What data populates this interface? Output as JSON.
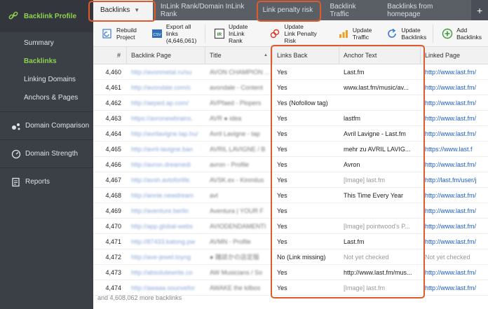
{
  "sidebar": {
    "header": "Backlink Profile",
    "subitems": [
      "Summary",
      "Backlinks",
      "Linking Domains",
      "Anchors & Pages"
    ],
    "active_index": 1,
    "sections": [
      "Domain Comparison",
      "Domain Strength",
      "Reports"
    ]
  },
  "tabs": [
    "Backlinks",
    "InLink Rank/Domain InLink Rank",
    "Link penalty risk",
    "Backlink Traffic",
    "Backlinks from homepage"
  ],
  "toolbar": [
    {
      "label": "Rebuild\nProject",
      "icon": "rebuild-icon"
    },
    {
      "label": "Export all links\n(4,646,061)",
      "icon": "csv-export-icon"
    },
    {
      "label": "Update\nInLink Rank",
      "icon": "ir-icon"
    },
    {
      "label": "Update\nLink Penalty Risk",
      "icon": "penalty-icon"
    },
    {
      "label": "Update\nTraffic",
      "icon": "traffic-icon"
    },
    {
      "label": "Update\nBacklinks",
      "icon": "refresh-icon"
    },
    {
      "label": "Add\nBacklinks",
      "icon": "add-icon"
    }
  ],
  "columns": [
    "#",
    "Backlink Page",
    "Title",
    "Links Back",
    "Anchor Text",
    "Linked Page"
  ],
  "rows": [
    {
      "n": "4,460",
      "page": "http://avonmetal.ru/su",
      "title": "AVON CHAMPION - Профи",
      "back": "Yes",
      "anchor": "Last.fm",
      "linked": "http://www.last.fm/",
      "anchor_grey": false
    },
    {
      "n": "4,461",
      "page": "http://avondale.com/c",
      "title": "avondale - Content",
      "back": "Yes",
      "anchor": "www.last.fm/music/av...",
      "linked": "http://www.last.fm/",
      "anchor_grey": false
    },
    {
      "n": "4,462",
      "page": "http://aeped.ap.com/",
      "title": "AVPfaed - Plopers",
      "back": "Yes (Nofollow tag)",
      "anchor": "",
      "linked": "http://www.last.fm/",
      "anchor_grey": false
    },
    {
      "n": "4,463",
      "page": "https://avronewbrains.",
      "title": "AVR ● idea",
      "back": "Yes",
      "anchor": "lastfm",
      "linked": "http://www.last.fm/",
      "anchor_grey": false
    },
    {
      "n": "4,464",
      "page": "http://avrilavigne.tap.hu/",
      "title": "Avril Lavigne - tap",
      "back": "Yes",
      "anchor": "Avril Lavigne - Last.fm",
      "linked": "http://www.last.fm/",
      "anchor_grey": false
    },
    {
      "n": "4,465",
      "page": "http://avril-lavigne.ban",
      "title": "AVRIL LAVIGNE / B",
      "back": "Yes",
      "anchor": "mehr zu AVRIL LAVIG...",
      "linked": "https://www.last.f",
      "anchor_grey": false
    },
    {
      "n": "4,466",
      "page": "http://avron.dreamedi",
      "title": "avron - Profile",
      "back": "Yes",
      "anchor": "Avron",
      "linked": "http://www.last.fm/",
      "anchor_grey": false
    },
    {
      "n": "4,467",
      "page": "http://avsh.avtoforlife.",
      "title": "AVSK.ex - Kinmilus",
      "back": "Yes",
      "anchor": "[Image] last.fm",
      "linked": "http://last.fm/user/j",
      "anchor_grey": true
    },
    {
      "n": "4,468",
      "page": "http://annie.newdream",
      "title": "avt",
      "back": "Yes",
      "anchor": "This Time Every Year",
      "linked": "http://www.last.fm/",
      "anchor_grey": false
    },
    {
      "n": "4,469",
      "page": "http://aventure.berlin",
      "title": "Aventura | YOUR F",
      "back": "Yes",
      "anchor": "",
      "linked": "http://www.last.fm/",
      "anchor_grey": false
    },
    {
      "n": "4,470",
      "page": "http://app.global-webs",
      "title": "AVIODENDAMENTI",
      "back": "Yes",
      "anchor": "[Image] pointwood's P...",
      "linked": "http://www.last.fm/",
      "anchor_grey": true
    },
    {
      "n": "4,471",
      "page": "http://87433.katong.pw",
      "title": "AVMN - Profile",
      "back": "Yes",
      "anchor": "Last.fm",
      "linked": "http://www.last.fm/",
      "anchor_grey": false
    },
    {
      "n": "4,472",
      "page": "http://ave-jewel.toyng",
      "title": "● 雑誌かの店定版",
      "back": "No (Link missing)",
      "anchor": "Not yet checked",
      "linked": "Not yet checked",
      "anchor_grey": true
    },
    {
      "n": "4,473",
      "page": "http://absolutewrite.co",
      "title": "AW Musicians / So",
      "back": "Yes",
      "anchor": "http://www.last.fm/mus...",
      "linked": "http://www.last.fm/",
      "anchor_grey": false
    },
    {
      "n": "4,474",
      "page": "http://awaaa.sounvefor",
      "title": "AWAKE the kilbos",
      "back": "Yes",
      "anchor": "[Image] last.fm",
      "linked": "http://www.last.fm/",
      "anchor_grey": true
    }
  ],
  "footer": "and 4,608,062 more backlinks",
  "colors": {
    "accent_green": "#8fd14f",
    "highlight": "#e05a2b",
    "link": "#1b5cc8"
  }
}
